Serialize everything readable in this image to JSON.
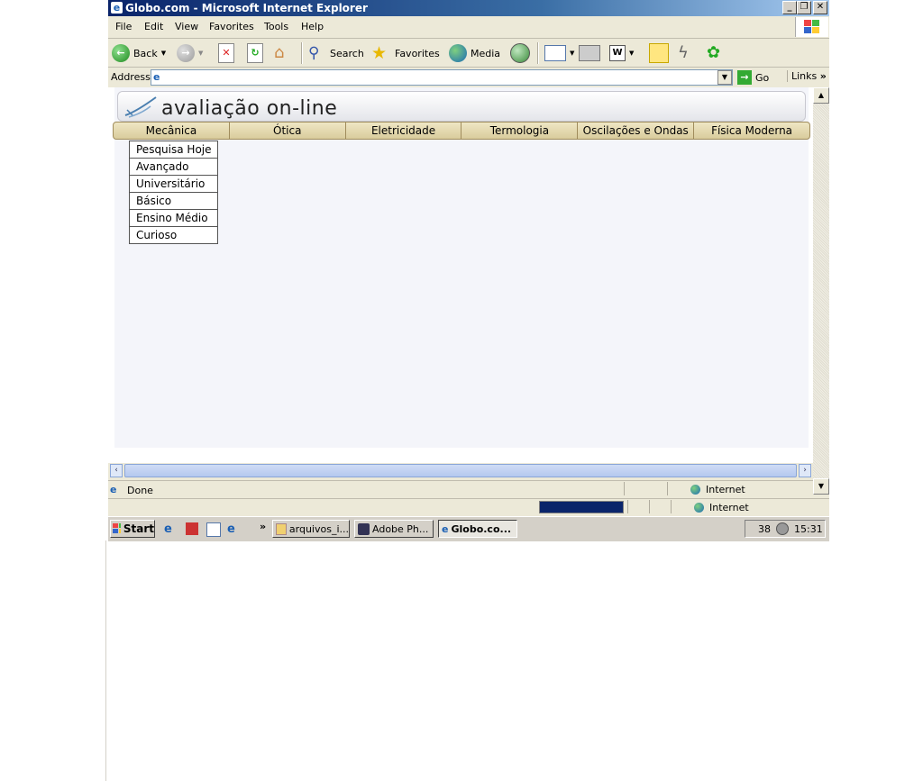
{
  "window": {
    "title": "Globo.com - Microsoft Internet Explorer"
  },
  "menubar": {
    "items": [
      "File",
      "Edit",
      "View",
      "Favorites",
      "Tools",
      "Help"
    ]
  },
  "toolbar": {
    "back": "Back",
    "search": "Search",
    "favorites": "Favorites",
    "media": "Media"
  },
  "addressbar": {
    "label": "Address",
    "value": "",
    "go": "Go",
    "links": "Links"
  },
  "page": {
    "banner_title": "avaliação on-line",
    "nav": [
      "Mecânica",
      "Ótica",
      "Eletricidade",
      "Termologia",
      "Oscilações e Ondas",
      "Física Moderna"
    ],
    "dropdown": [
      "Pesquisa Hoje",
      "Avançado",
      "Universitário",
      "Básico",
      "Ensino Médio",
      "Curioso"
    ]
  },
  "status": {
    "text": "Done",
    "zone": "Internet",
    "zone2": "Internet"
  },
  "taskbar": {
    "start": "Start",
    "tasks": [
      "arquivos_i...",
      "Adobe Ph...",
      "Globo.co..."
    ],
    "tray_number": "38",
    "clock": "15:31"
  },
  "colors": {
    "titlebar": "#0a246a",
    "content_bg": "#f4f5fa",
    "nav_bg": "#d9cc9c",
    "taskbar": "#d4d0c8"
  }
}
